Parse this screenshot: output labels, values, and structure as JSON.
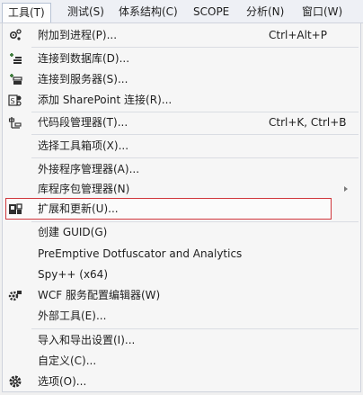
{
  "menubar": {
    "items": [
      {
        "label": "工具(T)"
      },
      {
        "label": "测试(S)"
      },
      {
        "label": "体系结构(C)"
      },
      {
        "label": "SCOPE"
      },
      {
        "label": "分析(N)"
      },
      {
        "label": "窗口(W)"
      }
    ]
  },
  "menu": {
    "items": [
      {
        "label": "附加到进程(P)...",
        "shortcut": "Ctrl+Alt+P",
        "icon": "attach-process-icon"
      },
      {
        "label": "连接到数据库(D)...",
        "icon": "connect-database-icon"
      },
      {
        "label": "连接到服务器(S)...",
        "icon": "connect-server-icon"
      },
      {
        "label": "添加 SharePoint 连接(R)...",
        "icon": "sharepoint-connection-icon"
      },
      {
        "label": "代码段管理器(T)...",
        "shortcut": "Ctrl+K, Ctrl+B",
        "icon": "snippet-manager-icon"
      },
      {
        "label": "选择工具箱项(X)..."
      },
      {
        "label": "外接程序管理器(A)..."
      },
      {
        "label": "库程序包管理器(N)",
        "has_submenu": true
      },
      {
        "label": "扩展和更新(U)...",
        "icon": "extensions-icon",
        "highlighted": true
      },
      {
        "label": "创建 GUID(G)"
      },
      {
        "label": "PreEmptive Dotfuscator and Analytics"
      },
      {
        "label": "Spy++ (x64)"
      },
      {
        "label": "WCF 服务配置编辑器(W)",
        "icon": "wcf-config-icon"
      },
      {
        "label": "外部工具(E)..."
      },
      {
        "label": "导入和导出设置(I)..."
      },
      {
        "label": "自定义(C)..."
      },
      {
        "label": "选项(O)...",
        "icon": "gear-icon"
      }
    ]
  },
  "colors": {
    "highlight_border": "#d0373c",
    "icon_accent": "#3c7a3a",
    "icon_dark": "#2f2f2f"
  }
}
